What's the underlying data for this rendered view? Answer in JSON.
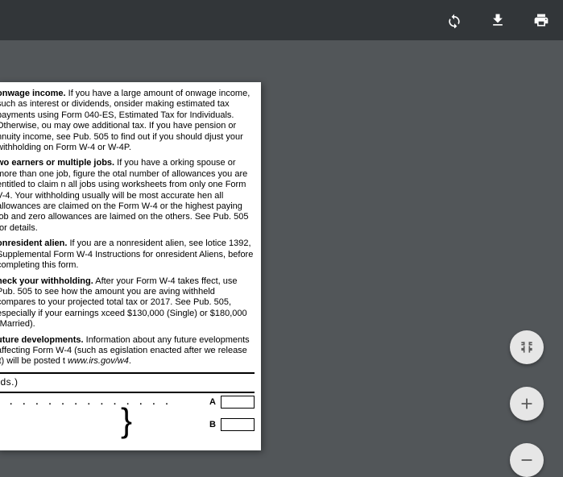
{
  "toolbar": {
    "rotate": "rotate",
    "download": "download",
    "print": "print"
  },
  "doc": {
    "sec1": {
      "head": "onwage income.",
      "body": " If you have a large amount of onwage income, such as interest or dividends, onsider making estimated tax payments using Form 040-ES, Estimated Tax for Individuals. Otherwise, ou may owe additional tax. If you have pension or nnuity income, see Pub. 505 to find out if you should djust your withholding on Form W-4 or W-4P."
    },
    "sec2": {
      "head": "wo earners or multiple jobs.",
      "body": " If you have a orking spouse or more than one job, figure the otal number of allowances you are entitled to claim n all jobs using worksheets from only one Form V-4. Your withholding usually will be most accurate hen all allowances are claimed on the Form W-4 or the highest paying job and zero allowances are laimed on the others. See Pub. 505 for details."
    },
    "sec3": {
      "head": "onresident alien.",
      "body": " If you are a nonresident alien, see lotice 1392, Supplemental Form W-4 Instructions for onresident Aliens, before completing this form."
    },
    "sec4": {
      "head": "heck your withholding.",
      "body": " After your Form W-4 takes ffect, use Pub. 505 to see how the amount you are aving withheld compares to your projected total tax or 2017. See Pub. 505, especially if your earnings xceed $130,000 (Single) or $180,000 (Married)."
    },
    "sec5": {
      "head": "uture developments.",
      "body": " Information about any future evelopments affecting Form W-4 (such as egislation enacted after we release it) will be posted t ",
      "url": "www.irs.gov/w4",
      "tail": "."
    },
    "records": "rds.)",
    "rowA": "A",
    "rowB": "B"
  },
  "floats": {
    "fit": "fit-to-page",
    "zoom_in": "zoom-in",
    "zoom_out": "zoom-out"
  }
}
